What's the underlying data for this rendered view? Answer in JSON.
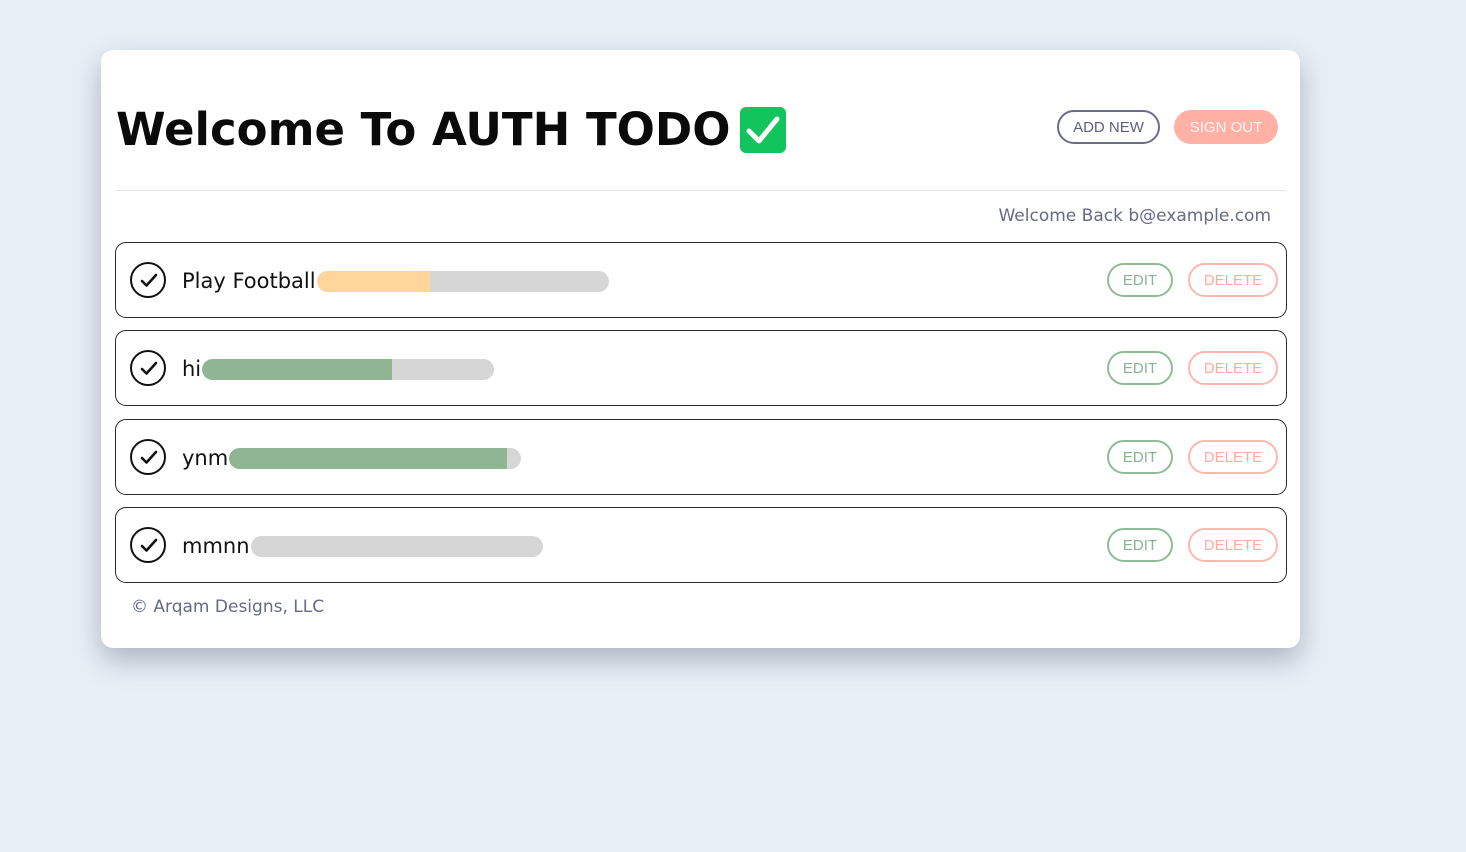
{
  "header": {
    "title": "Welcome To AUTH TODO",
    "title_icon": "check-mark-button-emoji",
    "add_new_label": "ADD NEW",
    "sign_out_label": "SIGN OUT"
  },
  "welcome_back": "Welcome Back b@example.com",
  "todos": [
    {
      "label": "Play Football",
      "progress": 0.39,
      "progress_color": "#ffd59c",
      "edit_label": "EDIT",
      "delete_label": "DELETE"
    },
    {
      "label": "hi",
      "progress": 0.65,
      "progress_color": "#8fb592",
      "edit_label": "EDIT",
      "delete_label": "DELETE"
    },
    {
      "label": "ynm",
      "progress": 0.95,
      "progress_color": "#8fb592",
      "edit_label": "EDIT",
      "delete_label": "DELETE"
    },
    {
      "label": "mmnn",
      "progress": 0.0,
      "progress_color": "#8fb592",
      "edit_label": "EDIT",
      "delete_label": "DELETE"
    }
  ],
  "footer": "© Arqam Designs, LLC",
  "colors": {
    "background": "#e8eff7",
    "accent_green": "#12c45c",
    "sign_out": "#ffb1a6",
    "edit": "#8ebc95",
    "delete": "#ffb8ae"
  }
}
